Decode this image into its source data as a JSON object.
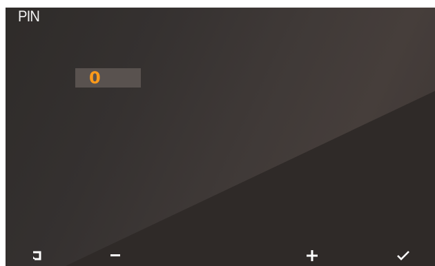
{
  "screen": {
    "title": "PIN",
    "pin_value": "0"
  },
  "softkeys": {
    "back_icon": "return-icon",
    "minus_icon": "minus-icon",
    "plus_icon": "plus-icon",
    "confirm_icon": "checkmark-icon"
  },
  "colors": {
    "accent": "#ff9a1a",
    "field_bg": "#59524f",
    "text": "#f2f2f2"
  }
}
